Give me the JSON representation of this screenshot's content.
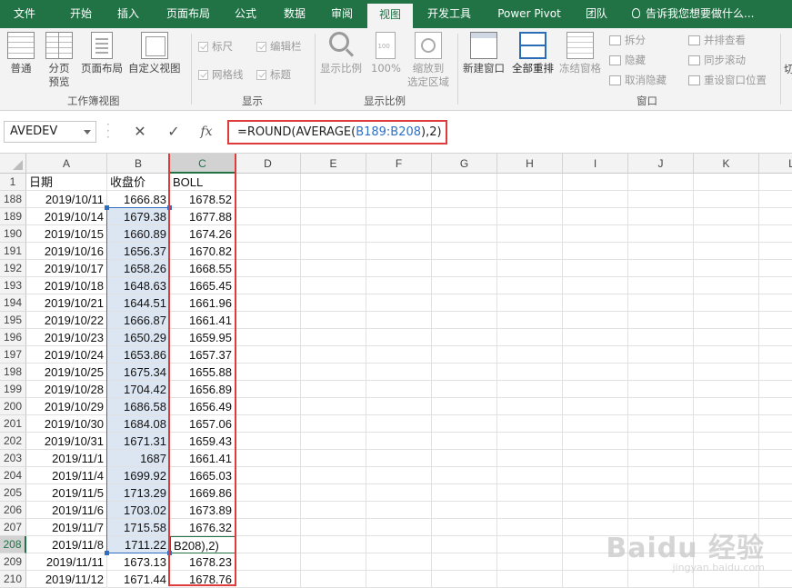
{
  "ribbon_tabs": [
    "文件",
    "开始",
    "插入",
    "页面布局",
    "公式",
    "数据",
    "审阅",
    "视图",
    "开发工具",
    "Power Pivot",
    "团队"
  ],
  "active_tab": "视图",
  "tell_me": "告诉我您想要做什么...",
  "ribbon": {
    "workbook_views": {
      "label": "工作簿视图",
      "normal": "普通",
      "page_break": "分页\n预览",
      "page_layout": "页面布局",
      "custom_views": "自定义视图"
    },
    "show": {
      "label": "显示",
      "ruler": "标尺",
      "formula_bar": "编辑栏",
      "gridlines": "网格线",
      "headings": "标题"
    },
    "zoom": {
      "label": "显示比例",
      "zoom": "显示比例",
      "hundred": "100%",
      "zoom_to_selection": "缩放到\n选定区域"
    },
    "window": {
      "label": "窗口",
      "new_window": "新建窗口",
      "arrange_all": "全部重排",
      "freeze_panes": "冻结窗格",
      "split": "拆分",
      "hide": "隐藏",
      "unhide": "取消隐藏",
      "side_by_side": "并排查看",
      "sync_scroll": "同步滚动",
      "reset_position": "重设窗口位置",
      "switch": "切"
    }
  },
  "formula_bar": {
    "name_box": "AVEDEV",
    "cancel": "✕",
    "enter": "✓",
    "fx": "fx",
    "formula_prefix": "=ROUND(AVERAGE(",
    "formula_ref": "B189:B208",
    "formula_suffix": "),2)"
  },
  "columns": [
    "A",
    "B",
    "C",
    "D",
    "E",
    "F",
    "G",
    "H",
    "I",
    "J",
    "K",
    "L"
  ],
  "selected_column": "C",
  "header_row": {
    "row": "1",
    "A": "日期",
    "B": "收盘价",
    "C": "BOLL"
  },
  "rows": [
    {
      "row": "188",
      "date": "2019/10/11",
      "close": "1666.83",
      "boll": "1678.52"
    },
    {
      "row": "189",
      "date": "2019/10/14",
      "close": "1679.38",
      "boll": "1677.88"
    },
    {
      "row": "190",
      "date": "2019/10/15",
      "close": "1660.89",
      "boll": "1674.26"
    },
    {
      "row": "191",
      "date": "2019/10/16",
      "close": "1656.37",
      "boll": "1670.82"
    },
    {
      "row": "192",
      "date": "2019/10/17",
      "close": "1658.26",
      "boll": "1668.55"
    },
    {
      "row": "193",
      "date": "2019/10/18",
      "close": "1648.63",
      "boll": "1665.45"
    },
    {
      "row": "194",
      "date": "2019/10/21",
      "close": "1644.51",
      "boll": "1661.96"
    },
    {
      "row": "195",
      "date": "2019/10/22",
      "close": "1666.87",
      "boll": "1661.41"
    },
    {
      "row": "196",
      "date": "2019/10/23",
      "close": "1650.29",
      "boll": "1659.95"
    },
    {
      "row": "197",
      "date": "2019/10/24",
      "close": "1653.86",
      "boll": "1657.37"
    },
    {
      "row": "198",
      "date": "2019/10/25",
      "close": "1675.34",
      "boll": "1655.88"
    },
    {
      "row": "199",
      "date": "2019/10/28",
      "close": "1704.42",
      "boll": "1656.89"
    },
    {
      "row": "200",
      "date": "2019/10/29",
      "close": "1686.58",
      "boll": "1656.49"
    },
    {
      "row": "201",
      "date": "2019/10/30",
      "close": "1684.08",
      "boll": "1657.06"
    },
    {
      "row": "202",
      "date": "2019/10/31",
      "close": "1671.31",
      "boll": "1659.43"
    },
    {
      "row": "203",
      "date": "2019/11/1",
      "close": "1687",
      "boll": "1661.41"
    },
    {
      "row": "204",
      "date": "2019/11/4",
      "close": "1699.92",
      "boll": "1665.03"
    },
    {
      "row": "205",
      "date": "2019/11/5",
      "close": "1713.29",
      "boll": "1669.86"
    },
    {
      "row": "206",
      "date": "2019/11/6",
      "close": "1703.02",
      "boll": "1673.89"
    },
    {
      "row": "207",
      "date": "2019/11/7",
      "close": "1715.58",
      "boll": "1676.32"
    },
    {
      "row": "208",
      "date": "2019/11/8",
      "close": "1711.22",
      "boll": "B208),2)",
      "editing": true
    },
    {
      "row": "209",
      "date": "2019/11/11",
      "close": "1673.13",
      "boll": "1678.23"
    },
    {
      "row": "210",
      "date": "2019/11/12",
      "close": "1671.44",
      "boll": "1678.76"
    }
  ],
  "watermark": {
    "logo": "Baidu 经验",
    "url": "jingyan.baidu.com"
  },
  "colors": {
    "excel_green": "#217346",
    "highlight_red": "#e03b3b",
    "range_blue": "#2e6fc4",
    "range_fill": "#dce6f2"
  }
}
